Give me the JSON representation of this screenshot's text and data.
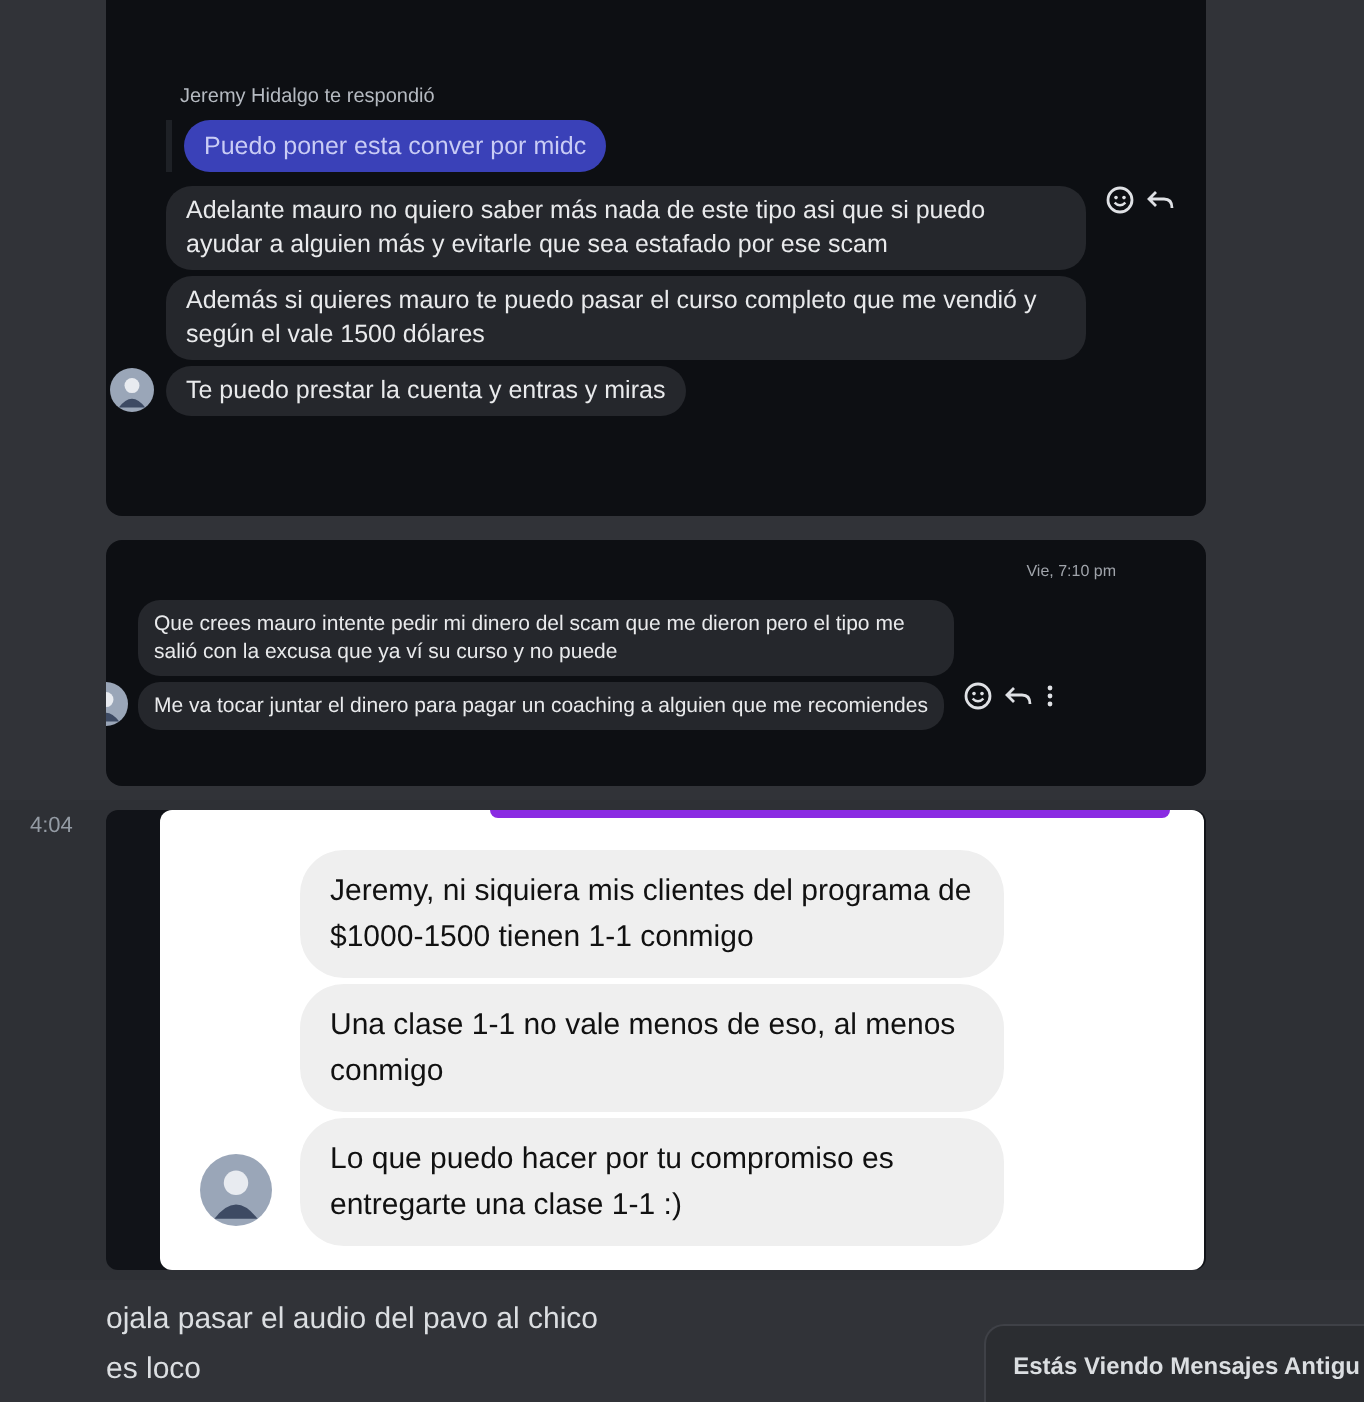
{
  "posts": [
    {
      "kind": "dark_chat",
      "reply": {
        "label": "Jeremy Hidalgo te respondió",
        "text": "Puedo poner esta conver por midc"
      },
      "bubbles": [
        {
          "text": "Adelante mauro no quiero saber más nada de este tipo asi que si puedo ayudar a alguien más y evitarle que sea estafado por ese scam",
          "hovered": true
        },
        {
          "text": "Además si quieres mauro te puedo pasar el curso completo que me vendió y según el vale 1500 dólares",
          "hovered": false
        },
        {
          "text": "Te puedo prestar la cuenta y entras y miras",
          "hovered": false
        }
      ]
    },
    {
      "kind": "dark_chat",
      "time": "Vie, 7:10 pm",
      "bubbles": [
        {
          "text": "Que crees mauro intente pedir mi dinero del scam que me dieron pero el tipo me salió con la excusa que ya ví su curso y no puede",
          "hovered": false
        },
        {
          "text": "Me va tocar juntar el dinero para pagar un coaching a alguien que me recomiendes",
          "hovered": true
        }
      ]
    },
    {
      "kind": "light_chat",
      "hovered": true,
      "timestamp": "4:04",
      "bubbles": [
        {
          "text": "Jeremy, ni siquiera mis clientes del programa de $1000-1500 tienen 1-1 conmigo",
          "hovered": false
        },
        {
          "text": "Una clase 1-1 no vale menos de eso, al menos conmigo",
          "hovered": false
        },
        {
          "text": "Lo que puedo hacer por tu compromiso es entregarte una clase 1-1 :)",
          "hovered": false
        }
      ]
    }
  ],
  "messages": [
    "ojala pasar el audio del pavo al chico",
    "es loco"
  ],
  "banner": "Estás Viendo Mensajes Antigu"
}
